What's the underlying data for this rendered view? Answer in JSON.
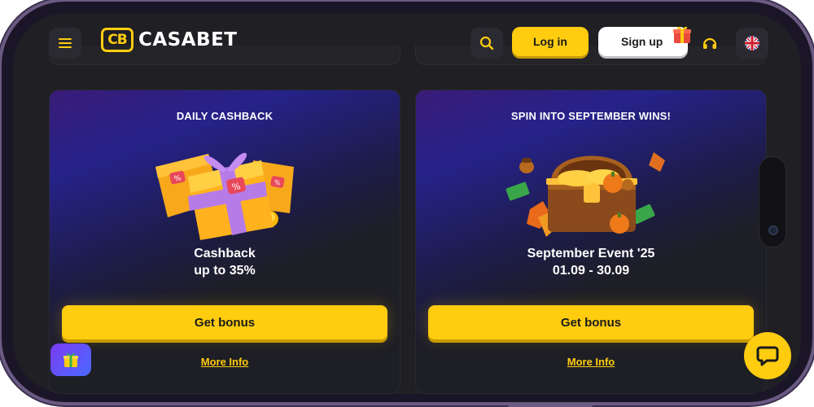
{
  "header": {
    "logo_badge": "CB",
    "logo_text": "CASABET",
    "login_label": "Log in",
    "signup_label": "Sign up"
  },
  "cards": [
    {
      "title": "DAILY CASHBACK",
      "line1": "Cashback",
      "line2": "up to 35%",
      "button": "Get bonus",
      "link": "More Info"
    },
    {
      "title": "SPIN INTO SEPTEMBER WINS!",
      "line1": "September Event '25",
      "line2": "01.09 - 30.09",
      "button": "Get bonus",
      "link": "More Info"
    }
  ],
  "colors": {
    "accent": "#ffcc10",
    "background": "#1f1f24",
    "card_gradient_start": "#3a1c78"
  },
  "icons": {
    "menu": "hamburger-icon",
    "search": "search-icon",
    "support": "headset-icon",
    "language": "uk-flag-icon",
    "chat": "chat-bubble-icon",
    "gift": "gift-icon"
  }
}
